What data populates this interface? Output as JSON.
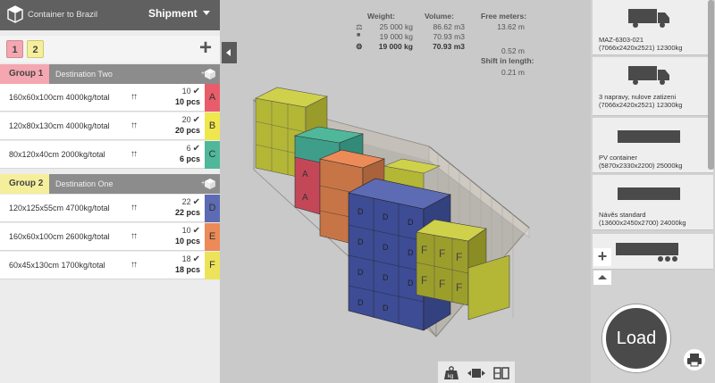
{
  "header": {
    "project_name": "Container to Brazil",
    "mode": "Shipment",
    "tabs": [
      "1",
      "2"
    ],
    "add_tab": "+"
  },
  "groups": [
    {
      "label": "Group 1",
      "destination": "Destination Two",
      "color": "#f4a7b0",
      "items": [
        {
          "desc": "160x60x100cm 4000kg/total",
          "count": "10",
          "pcs": "10 pcs",
          "letter": "A",
          "color": "#e95d6b"
        },
        {
          "desc": "120x80x130cm 4000kg/total",
          "count": "20",
          "pcs": "20 pcs",
          "letter": "B",
          "color": "#f0e64d"
        },
        {
          "desc": "80x120x40cm 2000kg/total",
          "count": "6",
          "pcs": "6 pcs",
          "letter": "C",
          "color": "#4fb89a"
        }
      ]
    },
    {
      "label": "Group 2",
      "destination": "Destination One",
      "color": "#f5ef9c",
      "items": [
        {
          "desc": "120x125x55cm 4700kg/total",
          "count": "22",
          "pcs": "22 pcs",
          "letter": "D",
          "color": "#5c6bb4"
        },
        {
          "desc": "160x60x100cm 2600kg/total",
          "count": "10",
          "pcs": "10 pcs",
          "letter": "E",
          "color": "#ec8a58"
        },
        {
          "desc": "60x45x130cm 1700kg/total",
          "count": "18",
          "pcs": "18 pcs",
          "letter": "F",
          "color": "#ede35a"
        }
      ]
    }
  ],
  "stats": {
    "weight_header": "Weight:",
    "volume_header": "Volume:",
    "free_header": "Free meters:",
    "weight_max": "25 000 kg",
    "weight_loaded": "19 000 kg",
    "weight_total": "19 000 kg",
    "volume_max": "86.62 m3",
    "volume_loaded": "70.93 m3",
    "volume_total": "70.93 m3",
    "free_1": "13.62 m",
    "free_2": "0.52 m",
    "shift_header": "Shift in length:",
    "shift_value": "0.21 m"
  },
  "vehicles": [
    {
      "line1": "MAZ-6303-021",
      "line2": "(7066x2420x2521) 12300kg"
    },
    {
      "line1": "3 napravy, nulove zatizeni",
      "line2": "(7066x2420x2521) 12300kg"
    },
    {
      "line1": "PV container",
      "line2": "(5870x2330x2200) 25000kg"
    },
    {
      "line1": "Návěs standard",
      "line2": "(13600x2450x2700) 24000kg"
    }
  ],
  "actions": {
    "load": "Load",
    "add_vehicle": "+",
    "kg_label": "kg"
  }
}
